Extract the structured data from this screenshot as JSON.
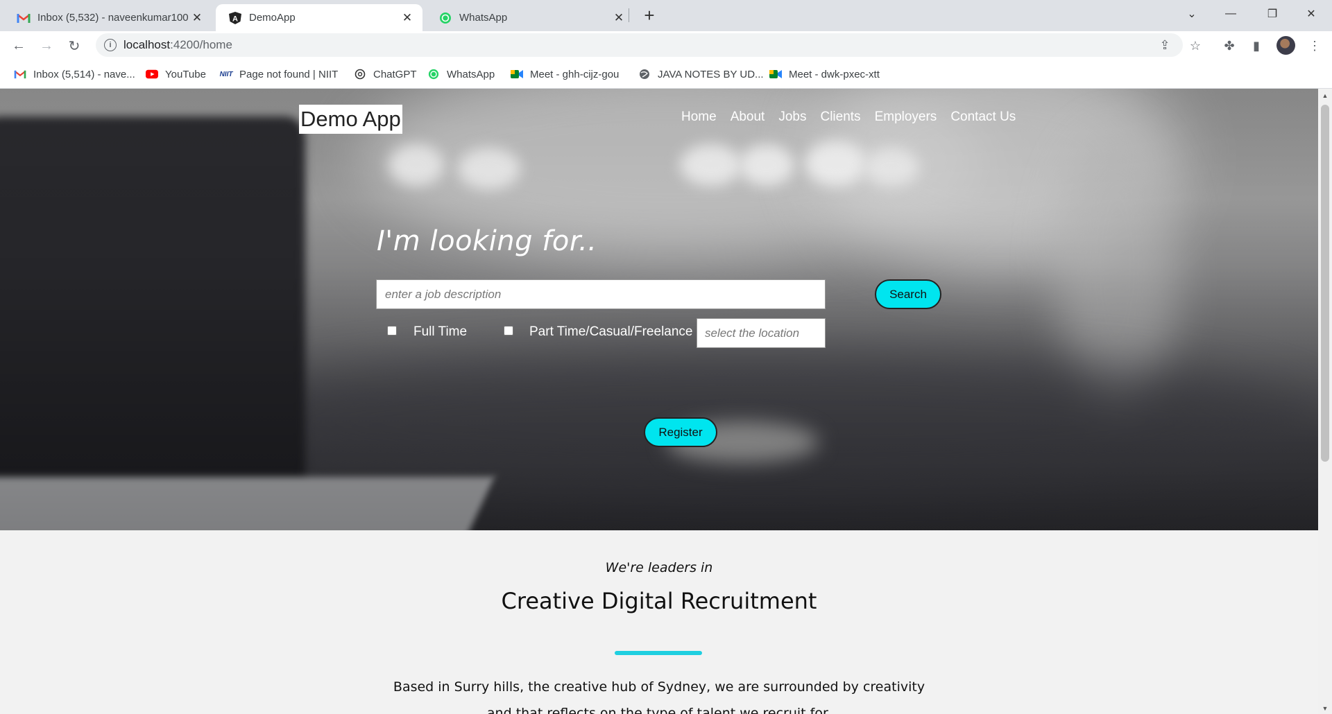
{
  "browser": {
    "tabs": [
      {
        "title": "Inbox (5,532) - naveenkumar100",
        "icon": "gmail-icon",
        "active": false
      },
      {
        "title": "DemoApp",
        "icon": "angular-icon",
        "active": true
      },
      {
        "title": "WhatsApp",
        "icon": "whatsapp-icon",
        "active": false
      }
    ],
    "new_tab": "+",
    "url_host": "localhost",
    "url_path": ":4200/home",
    "bookmarks": [
      {
        "label": "Inbox (5,514) - nave...",
        "icon": "gmail-icon"
      },
      {
        "label": "YouTube",
        "icon": "youtube-icon"
      },
      {
        "label": "Page not found | NIIT",
        "icon": "niit-icon"
      },
      {
        "label": "ChatGPT",
        "icon": "chatgpt-icon"
      },
      {
        "label": "WhatsApp",
        "icon": "whatsapp-icon"
      },
      {
        "label": "Meet - ghh-cijz-gou",
        "icon": "meet-icon"
      },
      {
        "label": "JAVA NOTES BY UD...",
        "icon": "globe-icon"
      },
      {
        "label": "Meet - dwk-pxec-xtt",
        "icon": "meet-icon"
      }
    ]
  },
  "app": {
    "brand": "Demo App",
    "nav": [
      "Home",
      "About",
      "Jobs",
      "Clients",
      "Employers",
      "Contact Us"
    ],
    "heading": "I'm looking for..",
    "job_placeholder": "enter a job description",
    "search_label": "Search",
    "full_time_label": "Full Time",
    "part_time_label": "Part Time/Casual/Freelance",
    "location_placeholder": "select the location",
    "register_label": "Register",
    "leaders_text": "We're leaders in",
    "headline": "Creative Digital Recruitment",
    "blurb": "Based in Surry hills, the creative hub of Sydney, we are surrounded by creativity",
    "blurb_cont": "and that reflects on the type of talent we recruit for."
  },
  "colors": {
    "accent": "#00e5ef",
    "bar": "#1fcfe0"
  }
}
